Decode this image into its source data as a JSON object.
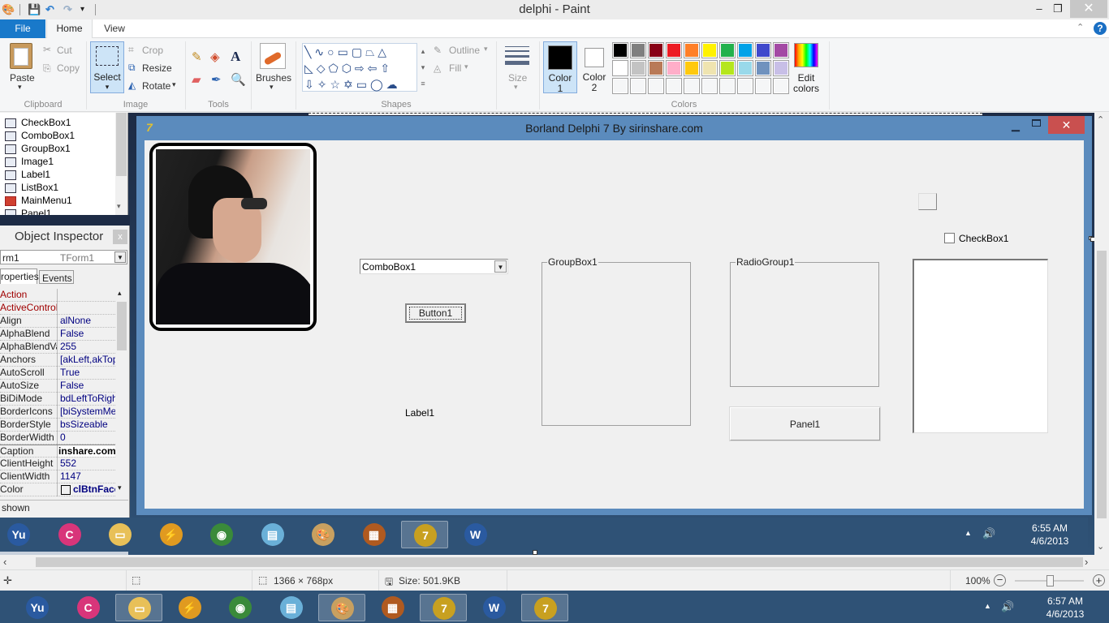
{
  "window": {
    "title": "delphi - Paint"
  },
  "quick_access": {
    "icons": [
      "paint-app-icon",
      "save-icon",
      "undo-icon",
      "redo-icon",
      "customize-qat-icon"
    ]
  },
  "window_controls": {
    "minimize": "–",
    "maximize": "❐",
    "close": "✕"
  },
  "tabs": [
    {
      "label": "File"
    },
    {
      "label": "Home"
    },
    {
      "label": "View"
    }
  ],
  "ribbon": {
    "clipboard": {
      "label": "Clipboard",
      "paste": "Paste",
      "cut": "Cut",
      "copy": "Copy"
    },
    "image": {
      "label": "Image",
      "select": "Select",
      "crop": "Crop",
      "resize": "Resize",
      "rotate": "Rotate"
    },
    "tools": {
      "label": "Tools"
    },
    "brushes": {
      "label": "Brushes"
    },
    "shapes": {
      "label": "Shapes",
      "outline": "Outline",
      "fill": "Fill"
    },
    "size": {
      "label": "Size"
    },
    "colors": {
      "label": "Colors",
      "color1": "Color\n1",
      "color1_l1": "Color",
      "color1_l2": "1",
      "color2_l1": "Color",
      "color2_l2": "2",
      "edit_l1": "Edit",
      "edit_l2": "colors",
      "color1_value": "#000000",
      "color2_value": "#ffffff",
      "palette_row1": [
        "#000000",
        "#7f7f7f",
        "#880015",
        "#ed1c24",
        "#ff7f27",
        "#fff200",
        "#22b14c",
        "#00a2e8",
        "#3f48cc",
        "#a349a4"
      ],
      "palette_row2": [
        "#ffffff",
        "#c3c3c3",
        "#b97a57",
        "#ffaec9",
        "#ffc90e",
        "#efe4b0",
        "#b5e61d",
        "#99d9ea",
        "#7092be",
        "#c8bfe7"
      ]
    }
  },
  "help_icon": "?",
  "delphi": {
    "tree_items": [
      {
        "label": "CheckBox1"
      },
      {
        "label": "ComboBox1"
      },
      {
        "label": "GroupBox1"
      },
      {
        "label": "Image1"
      },
      {
        "label": "Label1"
      },
      {
        "label": "ListBox1"
      },
      {
        "label": "MainMenu1"
      },
      {
        "label": "Panel1"
      }
    ],
    "object_inspector": {
      "title": "Object Inspector",
      "selected_object": "rm1",
      "selected_type": "TForm1",
      "tabs": [
        "roperties",
        "Events"
      ],
      "properties": [
        {
          "name": "Action",
          "value": "",
          "highlight": true
        },
        {
          "name": "ActiveControl",
          "value": "",
          "highlight": true
        },
        {
          "name": "Align",
          "value": "alNone"
        },
        {
          "name": "AlphaBlend",
          "value": "False"
        },
        {
          "name": "AlphaBlendValu",
          "value": "255"
        },
        {
          "name": "Anchors",
          "value": "[akLeft,akTop"
        },
        {
          "name": "AutoScroll",
          "value": "True"
        },
        {
          "name": "AutoSize",
          "value": "False"
        },
        {
          "name": "BiDiMode",
          "value": "bdLeftToRight"
        },
        {
          "name": "BorderIcons",
          "value": "[biSystemMen"
        },
        {
          "name": "BorderStyle",
          "value": "bsSizeable"
        },
        {
          "name": "BorderWidth",
          "value": "0"
        },
        {
          "name": "Caption",
          "value": "inshare.com",
          "editing": true
        },
        {
          "name": "ClientHeight",
          "value": "552"
        },
        {
          "name": "ClientWidth",
          "value": "1147"
        },
        {
          "name": "Color",
          "value": "clBtnFace",
          "bold": true
        }
      ],
      "status": "shown"
    },
    "form": {
      "title": "Borland Delphi 7 By sirinshare.com",
      "combobox": "ComboBox1",
      "button": "Button1",
      "label": "Label1",
      "groupbox": "GroupBox1",
      "radiogroup": "RadioGroup1",
      "panel": "Panel1",
      "checkbox": "CheckBox1",
      "checkbox_checked": false
    },
    "inner_taskbar": {
      "icons": [
        "yu-app-icon",
        "cleaner-app-icon",
        "file-explorer-icon",
        "winamp-icon",
        "chrome-icon",
        "notepad-icon",
        "paint-icon",
        "movie-maker-icon",
        "delphi7-icon",
        "word-icon"
      ],
      "active": "delphi7-icon",
      "time": "6:55 AM",
      "date": "4/6/2013"
    }
  },
  "statusbar": {
    "dimensions": "1366 × 768px",
    "size": "Size: 501.9KB",
    "zoom": "100%",
    "zoom_fraction": 0.5
  },
  "taskbar": {
    "icons": [
      "yu-app-icon",
      "cleaner-app-icon",
      "file-explorer-icon",
      "winamp-icon",
      "chrome-icon",
      "notepad-icon",
      "paint-icon",
      "movie-maker-icon",
      "delphi7-icon",
      "word-icon",
      "delphi7-lightning-icon"
    ],
    "active": [
      "file-explorer-icon",
      "paint-icon",
      "delphi7-icon",
      "delphi7-lightning-icon"
    ],
    "time": "6:57 AM",
    "date": "4/6/2013"
  }
}
